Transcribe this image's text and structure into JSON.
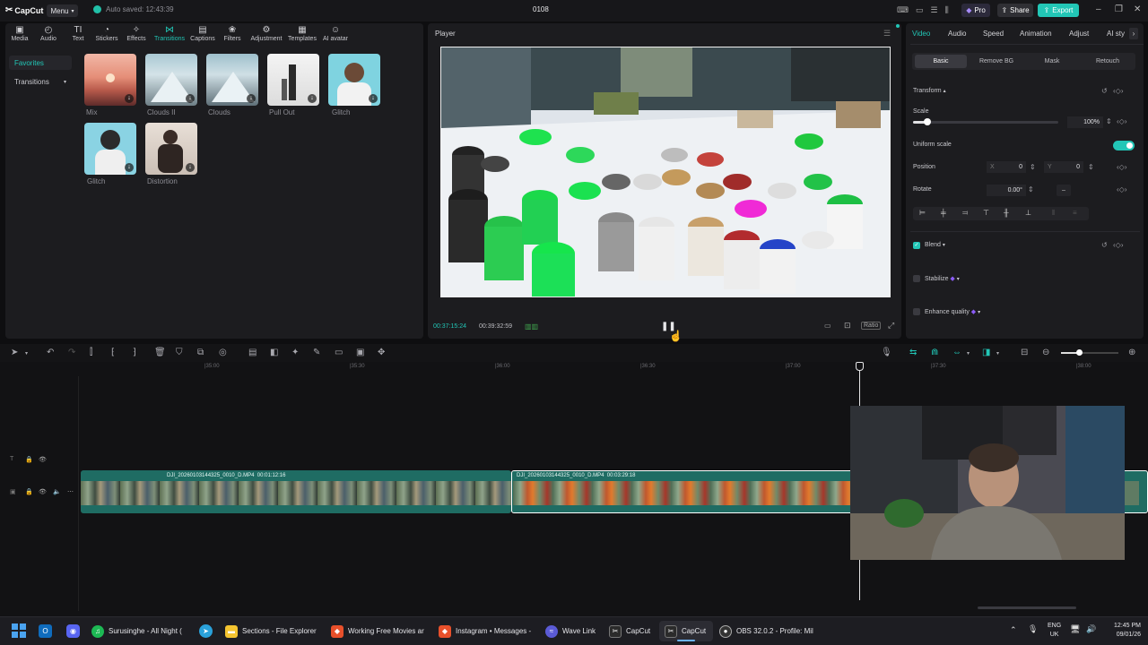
{
  "app": {
    "logo": "CapCut",
    "menu_label": "Menu",
    "autosave_text": "Auto saved: 12:43:39",
    "project_title": "0108",
    "pro_label": "Pro",
    "share_label": "Share",
    "export_label": "Export"
  },
  "toolbar": {
    "items": [
      {
        "label": "Media",
        "icon": "media-icon"
      },
      {
        "label": "Audio",
        "icon": "audio-icon"
      },
      {
        "label": "Text",
        "icon": "text-icon"
      },
      {
        "label": "Stickers",
        "icon": "stickers-icon"
      },
      {
        "label": "Effects",
        "icon": "effects-icon"
      },
      {
        "label": "Transitions",
        "icon": "transitions-icon"
      },
      {
        "label": "Captions",
        "icon": "captions-icon"
      },
      {
        "label": "Filters",
        "icon": "filters-icon"
      },
      {
        "label": "Adjustment",
        "icon": "adjustment-icon"
      },
      {
        "label": "Templates",
        "icon": "templates-icon"
      },
      {
        "label": "AI avatar",
        "icon": "ai-avatar-icon"
      }
    ],
    "active": "Transitions"
  },
  "sidebar": {
    "favorites": "Favorites",
    "transitions": "Transitions"
  },
  "transitions_grid": [
    {
      "label": "Mix"
    },
    {
      "label": "Clouds II"
    },
    {
      "label": "Clouds"
    },
    {
      "label": "Pull Out"
    },
    {
      "label": "Glitch"
    },
    {
      "label": "Glitch"
    },
    {
      "label": "Distortion"
    }
  ],
  "player": {
    "title": "Player",
    "current_time": "00:37:15:24",
    "total_time": "00:39:32:59",
    "ratio_label": "Ratio"
  },
  "inspector": {
    "tabs": [
      "Video",
      "Audio",
      "Speed",
      "Animation",
      "Adjust",
      "AI sty"
    ],
    "active_tab": "Video",
    "subtabs": [
      "Basic",
      "Remove BG",
      "Mask",
      "Retouch"
    ],
    "active_subtab": "Basic",
    "transform": "Transform",
    "scale_label": "Scale",
    "scale_value": "100%",
    "scale_level": 0.1,
    "uniform_scale": "Uniform scale",
    "uniform_scale_on": true,
    "position_label": "Position",
    "pos_x_label": "X",
    "pos_x": "0",
    "pos_y_label": "Y",
    "pos_y": "0",
    "rotate_label": "Rotate",
    "rotate_value": "0.00°",
    "blend": "Blend",
    "stabilize": "Stabilize",
    "enhance_quality": "Enhance quality"
  },
  "timeline": {
    "ruler": [
      "|35:00",
      "|35:30",
      "|36:00",
      "|36:30",
      "|37:00",
      "|37:30",
      "|38:00"
    ],
    "clips": [
      {
        "name": "DJI_20260103144325_0010_D.MP4",
        "duration": "00:01:12:16"
      },
      {
        "name": "DJI_20260103144325_0010_D.MP4",
        "duration": "00:03:29:18"
      }
    ]
  },
  "taskbar": {
    "items": [
      {
        "label": "Surusinghe - All Night (",
        "icon": "spotify-icon",
        "color": "#1db954"
      },
      {
        "label": "Sections - File Explorer",
        "icon": "folder-icon",
        "color": "#f4c430"
      },
      {
        "label": "Working Free Movies ar",
        "icon": "brave-icon",
        "color": "#e8502b"
      },
      {
        "label": "Instagram • Messages -",
        "icon": "brave-icon",
        "color": "#e8502b"
      },
      {
        "label": "Wave Link",
        "icon": "wave-link-icon",
        "color": "#5b5bd6"
      },
      {
        "label": "CapCut",
        "icon": "capcut-icon",
        "color": "#222"
      },
      {
        "label": "CapCut",
        "icon": "capcut-icon",
        "color": "#222"
      },
      {
        "label": "OBS 32.0.2 - Profile: Mil",
        "icon": "obs-icon",
        "color": "#333"
      }
    ],
    "lang_top": "ENG",
    "lang_bottom": "UK",
    "time": "12:45 PM",
    "date": "09/01/26"
  },
  "colors": {
    "accent": "#22c6b6",
    "track": "#1f6c63",
    "pro": "#8b5cf6"
  }
}
